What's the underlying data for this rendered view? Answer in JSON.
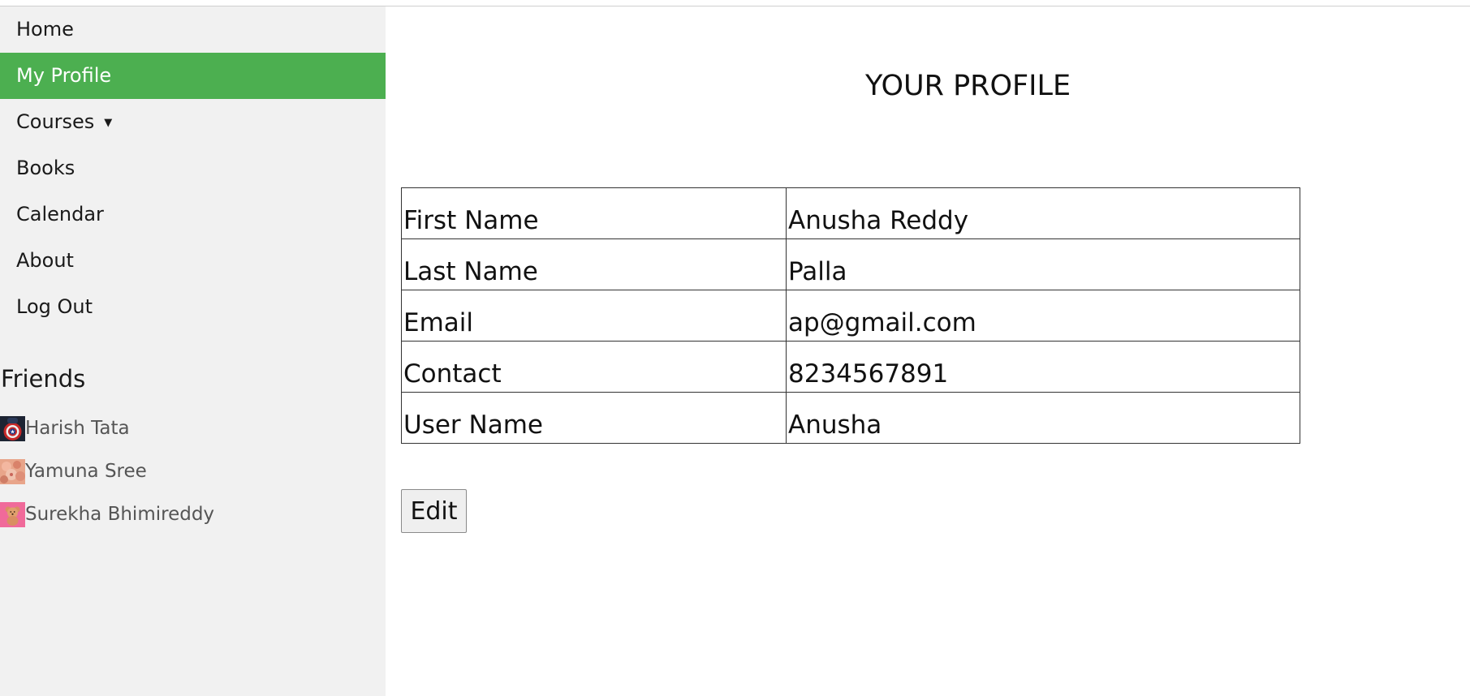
{
  "nav": {
    "items": [
      {
        "label": "Home"
      },
      {
        "label": "My Profile",
        "active": true
      },
      {
        "label": "Courses"
      },
      {
        "label": "Books"
      },
      {
        "label": "Calendar"
      },
      {
        "label": "About"
      },
      {
        "label": "Log Out"
      }
    ],
    "active_color": "#4caf50"
  },
  "friends": {
    "heading": "Friends",
    "list": [
      {
        "name": "Harish Tata",
        "avatar_icon": "captain-america-shield-avatar"
      },
      {
        "name": "Yamuna Sree",
        "avatar_icon": "flowers-avatar"
      },
      {
        "name": "Surekha Bhimireddy",
        "avatar_icon": "teddy-bear-avatar"
      }
    ]
  },
  "main": {
    "title": "YOUR PROFILE",
    "profile": [
      {
        "label": "First Name",
        "value": "Anusha Reddy"
      },
      {
        "label": "Last Name",
        "value": "Palla"
      },
      {
        "label": "Email",
        "value": "ap@gmail.com"
      },
      {
        "label": "Contact",
        "value": "8234567891"
      },
      {
        "label": "User Name",
        "value": "Anusha"
      }
    ],
    "edit_label": "Edit"
  }
}
